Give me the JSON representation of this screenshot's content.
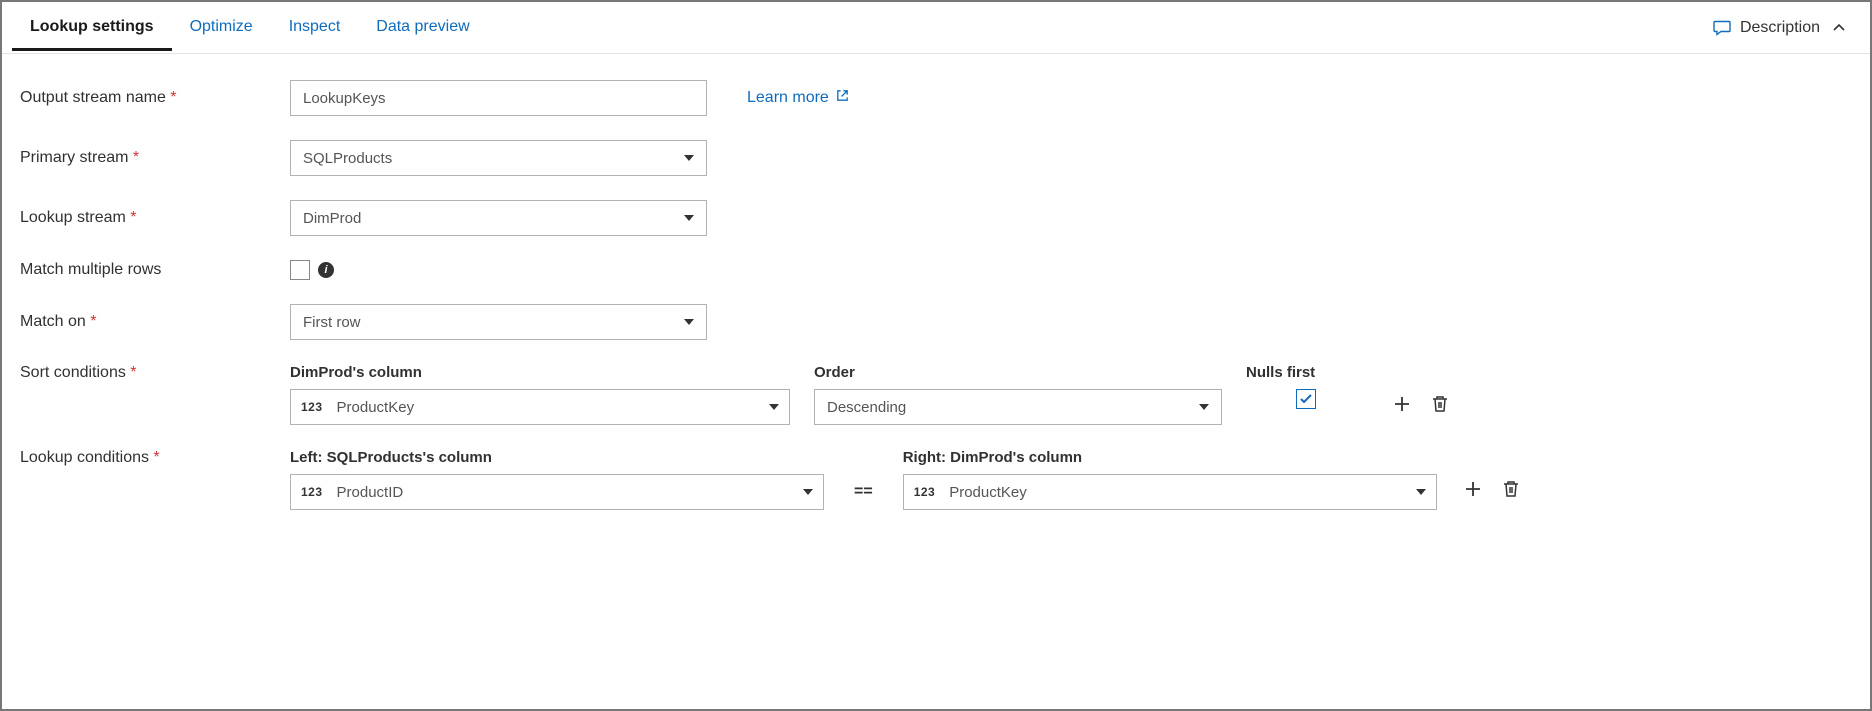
{
  "tabs": {
    "lookup_settings": "Lookup settings",
    "optimize": "Optimize",
    "inspect": "Inspect",
    "data_preview": "Data preview"
  },
  "description": "Description",
  "learn_more": "Learn more",
  "labels": {
    "output_stream_name": "Output stream name",
    "primary_stream": "Primary stream",
    "lookup_stream": "Lookup stream",
    "match_multiple_rows": "Match multiple rows",
    "match_on": "Match on",
    "sort_conditions": "Sort conditions",
    "lookup_conditions": "Lookup conditions"
  },
  "values": {
    "output_stream_name": "LookupKeys",
    "primary_stream": "SQLProducts",
    "lookup_stream": "DimProd",
    "match_multiple_rows": false,
    "match_on": "First row"
  },
  "sort": {
    "column_header": "DimProd's column",
    "order_header": "Order",
    "nulls_header": "Nulls first",
    "column_type": "123",
    "column": "ProductKey",
    "order": "Descending",
    "nulls_first": true
  },
  "lookup": {
    "left_header": "Left: SQLProducts's column",
    "right_header": "Right: DimProd's column",
    "left_type": "123",
    "left_column": "ProductID",
    "op": "==",
    "right_type": "123",
    "right_column": "ProductKey"
  }
}
